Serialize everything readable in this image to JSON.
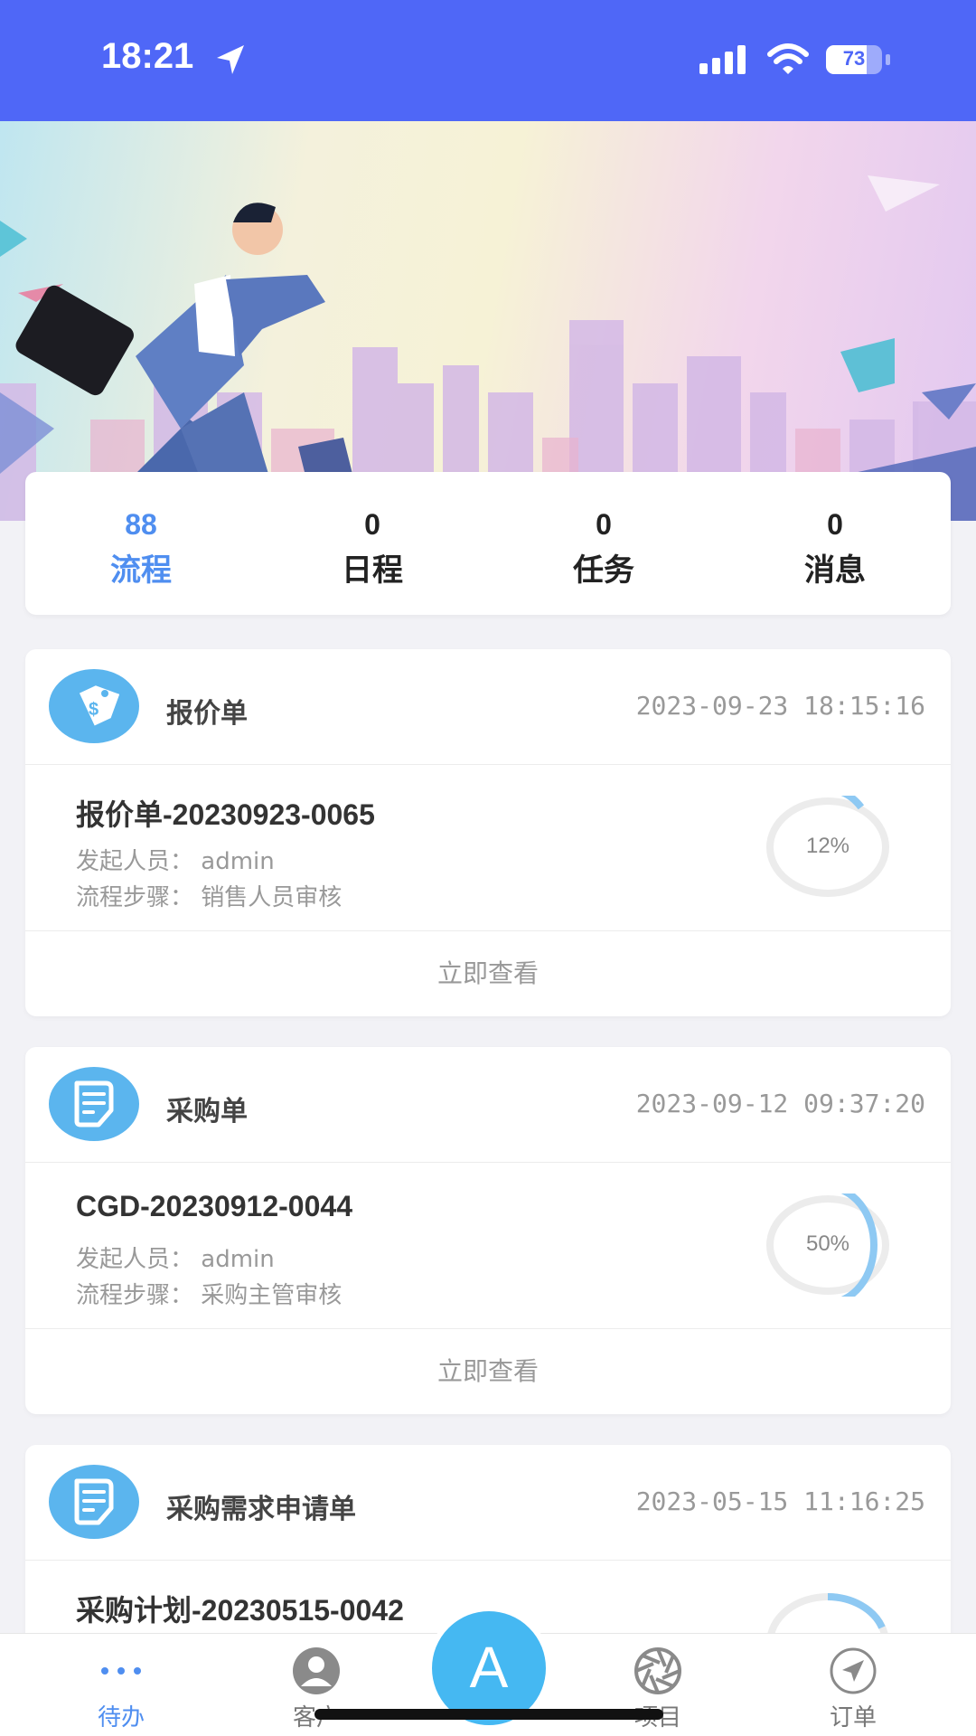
{
  "status_bar": {
    "time": "18:21",
    "battery": "73",
    "battery_level": 0.73
  },
  "stats": [
    {
      "count": "88",
      "label": "流程",
      "active": true
    },
    {
      "count": "0",
      "label": "日程",
      "active": false
    },
    {
      "count": "0",
      "label": "任务",
      "active": false
    },
    {
      "count": "0",
      "label": "消息",
      "active": false
    }
  ],
  "cards": [
    {
      "type": "报价单",
      "date": "2023-09-23 18:15:16",
      "code": "报价单-20230923-0065",
      "initiator": "发起人员：  admin",
      "step": "流程步骤：  销售人员审核",
      "progress_label": "12%",
      "progress": 0.12,
      "action": "立即查看",
      "icon": "price-tag-icon"
    },
    {
      "type": "采购单",
      "date": "2023-09-12 09:37:20",
      "code": "CGD-20230912-0044",
      "initiator": "发起人员：  admin",
      "step": "流程步骤：  采购主管审核",
      "progress_label": "50%",
      "progress": 0.5,
      "action": "立即查看",
      "icon": "document-icon"
    },
    {
      "type": "采购需求申请单",
      "date": "2023-05-15 11:16:25",
      "code": "采购计划-20230515-0042",
      "icon": "document-icon"
    }
  ],
  "tabbar": {
    "items": [
      {
        "label": "待办",
        "icon": "more-dots-icon",
        "active": true
      },
      {
        "label": "客户",
        "icon": "person-icon",
        "active": false
      },
      {
        "label": "项目",
        "icon": "aperture-icon",
        "active": false
      },
      {
        "label": "订单",
        "icon": "navigation-icon",
        "active": false
      }
    ],
    "center_label": "A"
  },
  "colors": {
    "primary": "#4f67f7",
    "accent": "#4f8ef0",
    "icon_bg": "#5bb5ee",
    "ring": "#8ec9f3"
  }
}
